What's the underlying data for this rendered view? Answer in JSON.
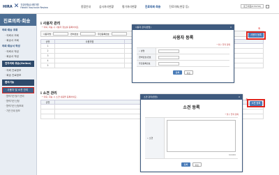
{
  "header": {
    "logo_abbr": "HIRA",
    "logo_line1": "건강보험심사평가원",
    "logo_line2": "Health Insurance Review",
    "nav": [
      "종합안내",
      "심사처리현황",
      "평가처리현황",
      "진료의뢰·회송",
      "진료의뢰(현장 등)"
    ],
    "active_nav": "진료의뢰·회송",
    "user": "로그아웃(0:59:59)",
    "home": "home-icon"
  },
  "sidebar": {
    "title": "진료의뢰·회송",
    "groups": [
      {
        "title": "의뢰·회송 조회",
        "items": [
          "· 의뢰서 조회",
          "· 회송서 조회"
        ]
      },
      {
        "title": "의뢰·회송서 작성",
        "items": [
          "· 의뢰서 작성",
          "· 회송서 작성"
        ]
      }
    ],
    "bar1": "전자의뢰·회송(Online)",
    "bar1_items": [
      "· 의뢰 진료정보",
      "· 회송 진료정보"
    ],
    "bar2": "편의기능",
    "selected": "· 사용자 및 소견 관리",
    "sub_items": [
      "· 협력기관 찾기 관리",
      "· 협력기관 신청",
      "· 협력기관 신청조회",
      "· 기관 안내 정보"
    ]
  },
  "page": {
    "sec1_title": "ℹ 사용자 관리",
    "sec1_note": "* 의뢰, 회송 시 사용자 정보를 등록하세요.",
    "filter_labels": [
      "사용자명",
      "면허번호",
      "주민등록번호"
    ],
    "search_label": "조회",
    "table_headers": [
      "순번",
      "사용자명",
      "면허번호",
      "주민등록번호"
    ],
    "rows": [
      "1",
      "2",
      "3",
      "4",
      "5"
    ],
    "reg_btn": "사용자 등록",
    "sec2_title": "ℹ 소견 관리",
    "sec2_note": "* 의뢰, 회송 시 소견 내용을 등록하세요.",
    "table2_headers": [
      "순번",
      "소견명"
    ],
    "reg2_btn": "소견 등록",
    "marker1": "①",
    "marker2": "②"
  },
  "modal1": {
    "head": "사용자 관리(팝업)",
    "close": "X",
    "title": "사용자 등록",
    "note": "* 필수 입력 항목",
    "fields": [
      "• 성명",
      "면허번호/번호",
      "주민등록번호"
    ],
    "ok": "등록",
    "cancel": "취소"
  },
  "modal2": {
    "head": "소견 관리(팝업)",
    "close": "X",
    "title": "소견 등록",
    "note": "* 필수 입력 항목",
    "label": "• 소견",
    "count": "0/1000",
    "ok": "등록",
    "cancel": "취소"
  }
}
